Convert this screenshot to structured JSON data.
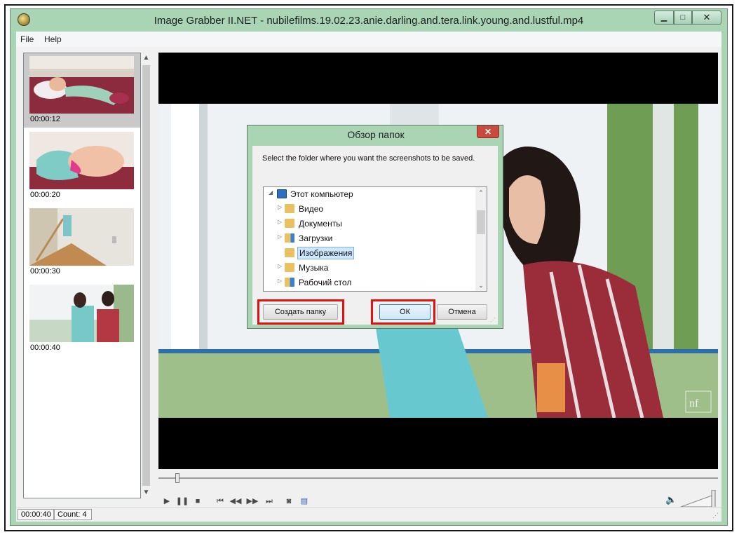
{
  "window": {
    "title": "Image Grabber II.NET - nubilefilms.19.02.23.anie.darling.and.tera.link.young.and.lustful.mp4",
    "buttons": {
      "minimize": "▁",
      "maximize": "□",
      "close": "✕"
    }
  },
  "menu": {
    "items": [
      "File",
      "Help"
    ]
  },
  "thumbnails": [
    {
      "timecode": "00:00:12",
      "selected": true
    },
    {
      "timecode": "00:00:20",
      "selected": false
    },
    {
      "timecode": "00:00:30",
      "selected": false
    },
    {
      "timecode": "00:00:40",
      "selected": false
    }
  ],
  "player": {
    "controls": [
      "play-icon",
      "pause-icon",
      "stop-icon",
      "skip-start-icon",
      "step-back-icon",
      "step-forward-icon",
      "skip-end-icon",
      "camera-icon",
      "film-icon"
    ],
    "seek_position": 0.03,
    "volume": 1.0,
    "watermark": "nf"
  },
  "statusbar": {
    "time": "00:00:40",
    "count": "Count: 4"
  },
  "dialog": {
    "title": "Обзор папок",
    "description": "Select the folder where you want the screenshots to be saved.",
    "tree": [
      {
        "label": "Этот компьютер",
        "expanded": true,
        "level": 0,
        "icon": "computer-icon"
      },
      {
        "label": "Видео",
        "expanded": false,
        "level": 1,
        "icon": "video-folder-icon"
      },
      {
        "label": "Документы",
        "expanded": false,
        "level": 1,
        "icon": "documents-folder-icon"
      },
      {
        "label": "Загрузки",
        "expanded": false,
        "level": 1,
        "icon": "downloads-folder-icon"
      },
      {
        "label": "Изображения",
        "expanded": false,
        "level": 1,
        "icon": "pictures-folder-icon",
        "selected": true
      },
      {
        "label": "Музыка",
        "expanded": false,
        "level": 1,
        "icon": "music-folder-icon"
      },
      {
        "label": "Рабочий стол",
        "expanded": false,
        "level": 1,
        "icon": "desktop-folder-icon"
      }
    ],
    "buttons": {
      "new_folder": "Создать папку",
      "ok": "ОК",
      "cancel": "Отмена"
    }
  },
  "colors": {
    "frame": "#a9d5b4",
    "highlight": "#e21111",
    "selection": "#cde8ff"
  }
}
